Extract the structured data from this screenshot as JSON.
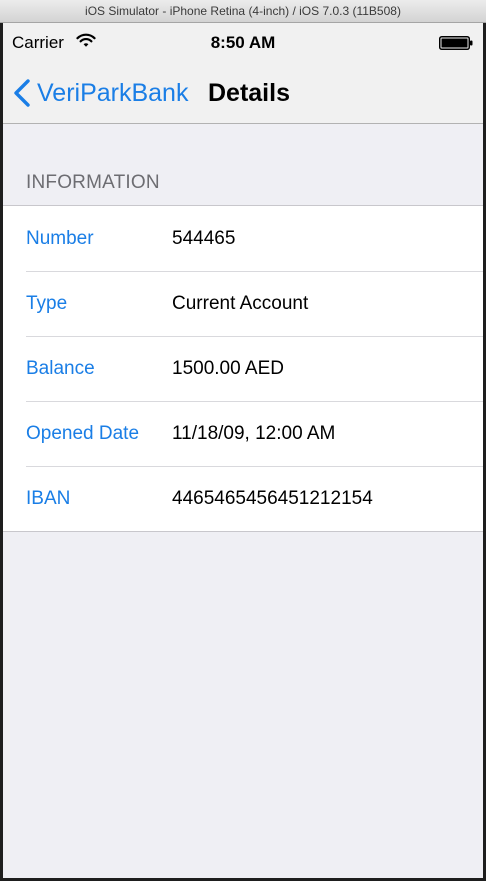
{
  "window": {
    "title": "iOS Simulator - iPhone Retina (4-inch) / iOS 7.0.3 (11B508)"
  },
  "status_bar": {
    "carrier": "Carrier",
    "wifi_icon": "wifi-icon",
    "time": "8:50 AM",
    "battery_icon": "battery-icon"
  },
  "nav_bar": {
    "back_icon": "chevron-left-icon",
    "back_label": "VeriParkBank",
    "title": "Details"
  },
  "section": {
    "header": "INFORMATION",
    "rows": [
      {
        "label": "Number",
        "value": "544465"
      },
      {
        "label": "Type",
        "value": "Current Account"
      },
      {
        "label": "Balance",
        "value": "1500.00 AED"
      },
      {
        "label": "Opened Date",
        "value": "11/18/09, 12:00 AM"
      },
      {
        "label": "IBAN",
        "value": "4465465456451212154"
      }
    ]
  },
  "colors": {
    "tint": "#1a7ee6",
    "background": "#efeff4",
    "section_header": "#6d6d72"
  }
}
